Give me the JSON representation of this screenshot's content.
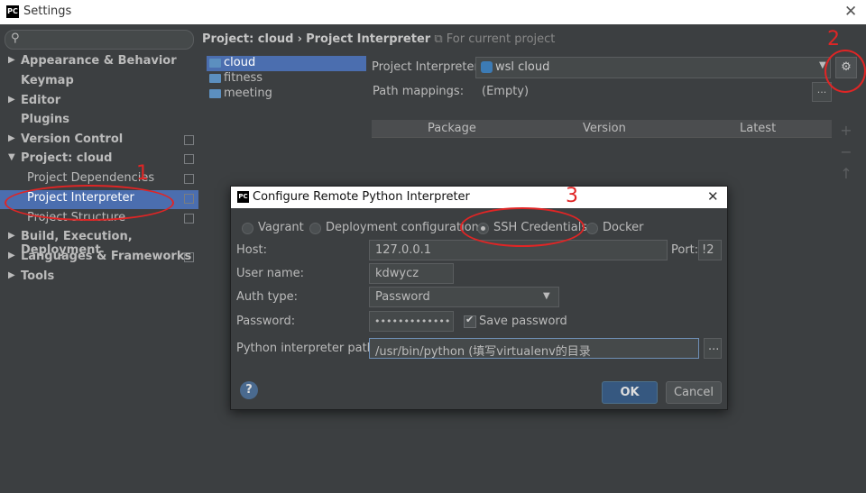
{
  "window": {
    "app_icon": "PC",
    "title": "Settings",
    "close_glyph": "✕"
  },
  "sidebar": {
    "search_placeholder": "",
    "items": [
      {
        "label": "Appearance & Behavior",
        "arrow": "▶",
        "bold": true,
        "copy": false
      },
      {
        "label": "Keymap",
        "arrow": "",
        "bold": true,
        "copy": false
      },
      {
        "label": "Editor",
        "arrow": "▶",
        "bold": true,
        "copy": false
      },
      {
        "label": "Plugins",
        "arrow": "",
        "bold": true,
        "copy": false
      },
      {
        "label": "Version Control",
        "arrow": "▶",
        "bold": true,
        "copy": true
      },
      {
        "label": "Project: cloud",
        "arrow": "▼",
        "bold": true,
        "copy": true
      },
      {
        "label": "Project Dependencies",
        "arrow": "",
        "bold": false,
        "copy": true
      },
      {
        "label": "Project Interpreter",
        "arrow": "",
        "bold": false,
        "copy": true,
        "selected": true
      },
      {
        "label": "Project Structure",
        "arrow": "",
        "bold": false,
        "copy": true
      },
      {
        "label": "Build, Execution, Deployment",
        "arrow": "▶",
        "bold": true,
        "copy": false
      },
      {
        "label": "Languages & Frameworks",
        "arrow": "▶",
        "bold": true,
        "copy": true
      },
      {
        "label": "Tools",
        "arrow": "▶",
        "bold": true,
        "copy": false
      }
    ]
  },
  "breadcrumb": {
    "part1": "Project: cloud",
    "sep": "›",
    "part2": "Project Interpreter",
    "hint": "For current project"
  },
  "projects": [
    "cloud",
    "fitness",
    "meeting"
  ],
  "interpreter": {
    "label": "Project Interpreter:",
    "value": "wsl cloud",
    "dropdown": "▼",
    "gear": "⚙"
  },
  "path_mappings": {
    "label": "Path mappings:",
    "value": "(Empty)",
    "button": "..."
  },
  "packages_table": {
    "columns": [
      "Package",
      "Version",
      "Latest"
    ],
    "tools": [
      "+",
      "−",
      "↑"
    ]
  },
  "dialog": {
    "app_icon": "PC",
    "title": "Configure Remote Python Interpreter",
    "close_glyph": "✕",
    "options": [
      {
        "label": "Vagrant",
        "selected": false
      },
      {
        "label": "Deployment configuration",
        "selected": false
      },
      {
        "label": "SSH Credentials",
        "selected": true
      },
      {
        "label": "Docker",
        "selected": false
      }
    ],
    "host": {
      "label": "Host:",
      "value": "127.0.0.1"
    },
    "port": {
      "label": "Port:",
      "value": "!2"
    },
    "user": {
      "label": "User name:",
      "value": "kdwycz"
    },
    "auth": {
      "label": "Auth type:",
      "value": "Password",
      "dropdown": "▼"
    },
    "password": {
      "label": "Password:",
      "value": "•••••••••••••"
    },
    "save_password": {
      "label": "Save password",
      "checked": true
    },
    "interp_path": {
      "label": "Python interpreter path:",
      "value": "/usr/bin/python (填写virtualenv的目录",
      "button": "..."
    },
    "help": "?",
    "ok": "OK",
    "cancel": "Cancel"
  },
  "annotations": {
    "n1": "1",
    "n2": "2",
    "n3": "3",
    "color": "#e02525"
  }
}
